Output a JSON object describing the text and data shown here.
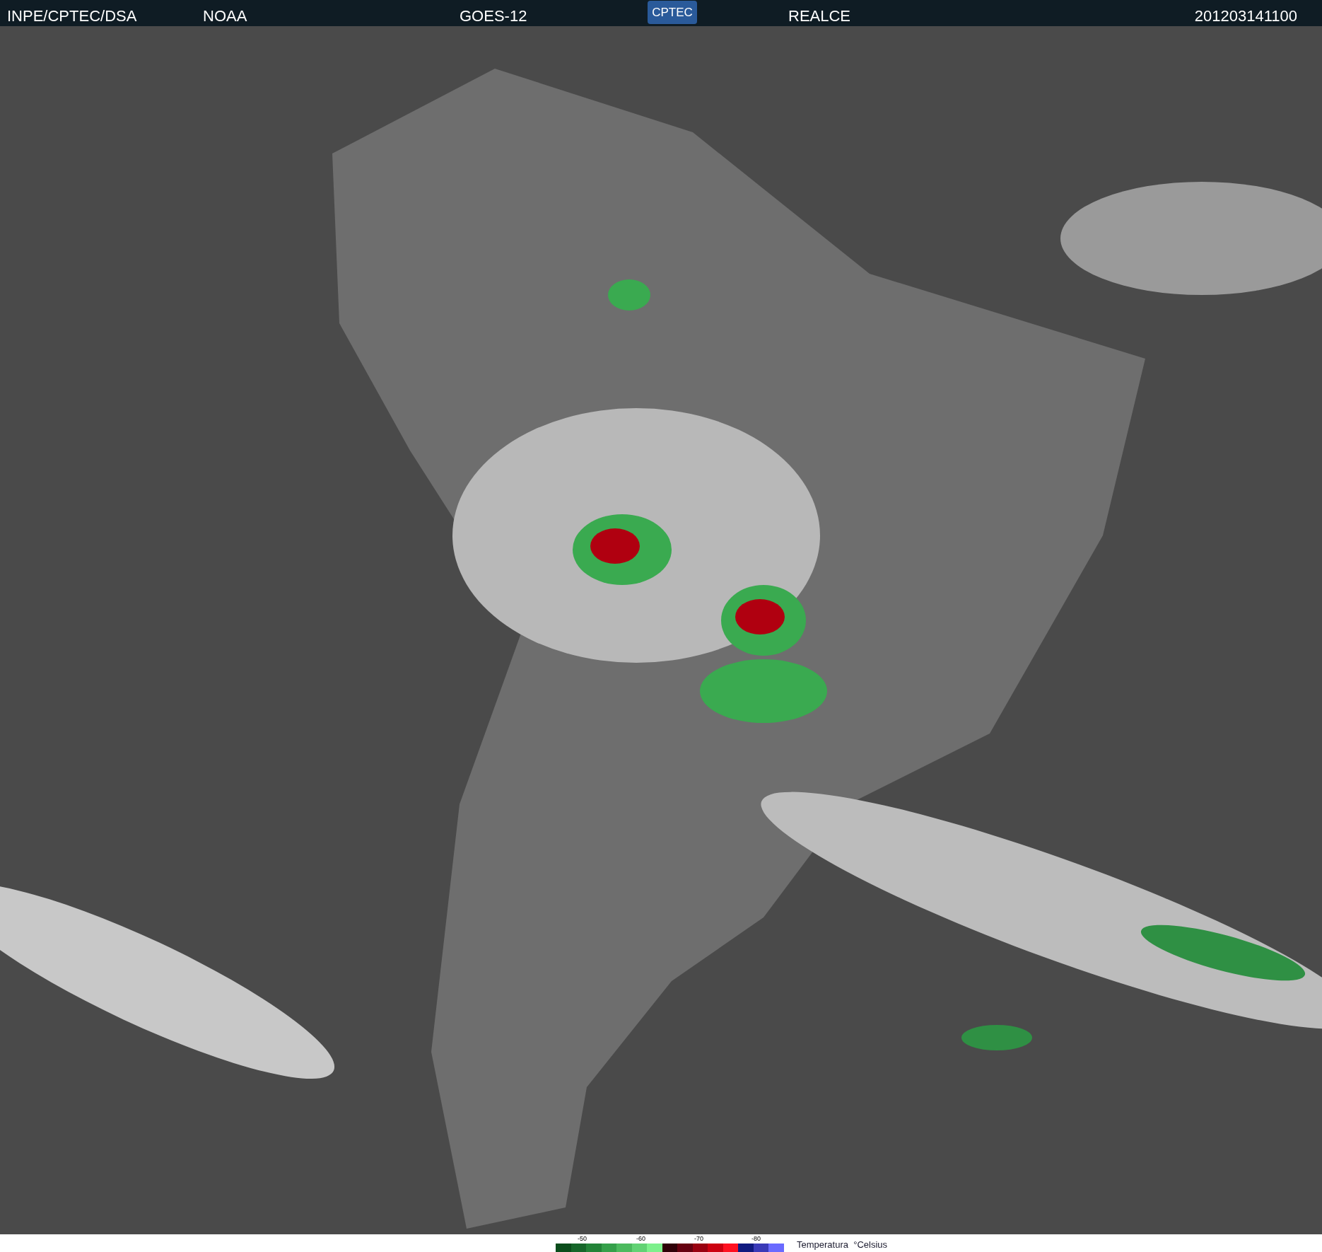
{
  "header": {
    "source": "INPE/CPTEC/DSA",
    "agency": "NOAA",
    "satellite": "GOES-12",
    "logo": "CPTEC",
    "product": "REALCE",
    "timestamp": "201203141100"
  },
  "legend": {
    "title": "Temperatura  °Celsius",
    "ticks": [
      "-50",
      "-60",
      "-70",
      "-80"
    ],
    "swatches": [
      {
        "color": "#0b4d1c"
      },
      {
        "color": "#16662a"
      },
      {
        "color": "#238338"
      },
      {
        "color": "#35a04a"
      },
      {
        "color": "#4cba5e"
      },
      {
        "color": "#62d274"
      },
      {
        "color": "#7df08c"
      },
      {
        "color": "#300008"
      },
      {
        "color": "#660010"
      },
      {
        "color": "#990010"
      },
      {
        "color": "#cc0010"
      },
      {
        "color": "#ff1020"
      },
      {
        "color": "#101a80"
      },
      {
        "color": "#3a3ab8"
      },
      {
        "color": "#6a6aff"
      }
    ]
  }
}
